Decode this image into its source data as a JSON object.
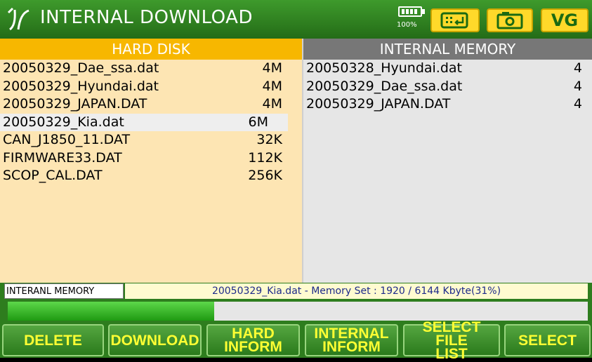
{
  "title": "INTERNAL DOWNLOAD",
  "status_icons": {
    "battery_percent": "100%",
    "vg_label": "VG"
  },
  "left_panel": {
    "header": "HARD DISK",
    "files": [
      {
        "name": "20050329_Dae_ssa.dat",
        "size": "4M"
      },
      {
        "name": "20050329_Hyundai.dat",
        "size": "4M"
      },
      {
        "name": "20050329_JAPAN.DAT",
        "size": "4M"
      },
      {
        "name": "20050329_Kia.dat",
        "size": "6M",
        "selected": true
      },
      {
        "name": "CAN_J1850_11.DAT",
        "size": "32K"
      },
      {
        "name": "FIRMWARE33.DAT",
        "size": "112K"
      },
      {
        "name": "SCOP_CAL.DAT",
        "size": "256K"
      }
    ]
  },
  "right_panel": {
    "header": "INTERNAL MEMORY",
    "files": [
      {
        "name": "20050328_Hyundai.dat",
        "size": "4"
      },
      {
        "name": "20050329_Dae_ssa.dat",
        "size": "4"
      },
      {
        "name": "20050329_JAPAN.DAT",
        "size": "4"
      }
    ]
  },
  "status": {
    "label": "INTERANL MEMORY",
    "text": "20050329_Kia.dat - Memory Set : 1920 / 6144 Kbyte(31%)"
  },
  "progress": {
    "fraction": 0.356
  },
  "buttons": {
    "delete": "DELETE",
    "download": "DOWNLOAD",
    "hard_inform": [
      "HARD",
      "INFORM"
    ],
    "internal_inform": [
      "INTERNAL",
      "INFORM"
    ],
    "select_file_list": [
      "SELECT FILE",
      "LIST"
    ],
    "select": "SELECT"
  },
  "colors": {
    "title_bar": "#2e7d1e",
    "hard_disk_header": "#f7b700",
    "internal_memory_header": "#777777",
    "button_text": "#ffff33"
  }
}
